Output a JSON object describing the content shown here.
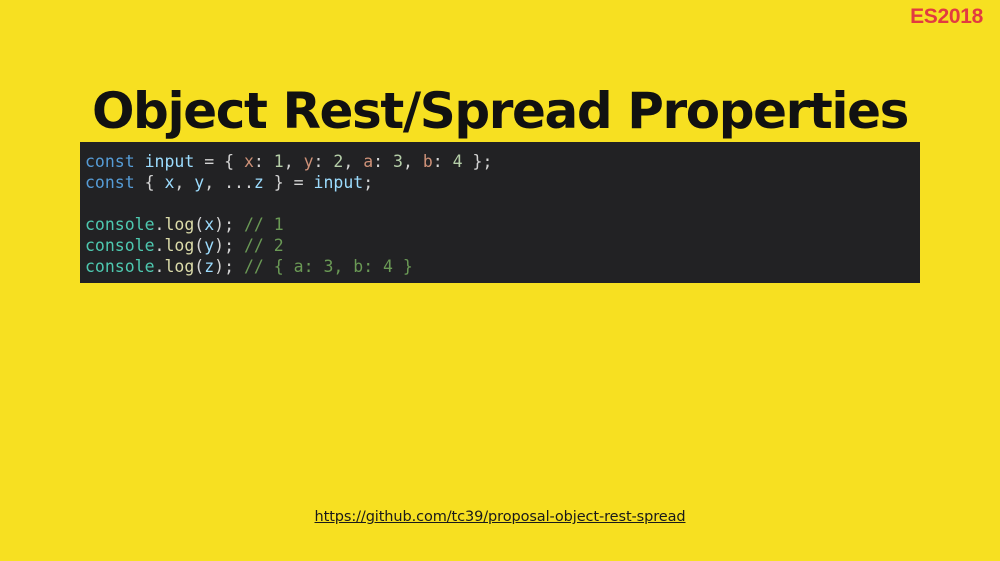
{
  "slide": {
    "background_color": "#F7E021",
    "badge": {
      "label": "ES2018",
      "color": "#E23B40"
    },
    "title": "Object Rest/Spread Properties",
    "title_color": "#111111",
    "source_url": "https://github.com/tc39/proposal-object-rest-spread"
  },
  "code_block": {
    "background_color": "#222224",
    "language": "javascript",
    "theme": "vscode-dark-plus",
    "default_text_color": "#D4D4D4",
    "token_colors": {
      "keyword": "#569CD6",
      "variable": "#9CDCFE",
      "property": "#CE9178",
      "number": "#B5CEA8",
      "object": "#4EC9B0",
      "function": "#DCDCAA",
      "comment": "#6A9955",
      "punctuation": "#D4D4D4"
    },
    "plain_text": "const input = { x: 1, y: 2, a: 3, b: 4 };\nconst { x, y, ...z } = input;\n\nconsole.log(x); // 1\nconsole.log(y); // 2\nconsole.log(z); // { a: 3, b: 4 }",
    "lines": [
      {
        "index": 1,
        "tokens": [
          {
            "t": "const",
            "c": "kw"
          },
          {
            "t": " ",
            "c": "punc"
          },
          {
            "t": "input",
            "c": "var"
          },
          {
            "t": " = { ",
            "c": "punc"
          },
          {
            "t": "x",
            "c": "prop"
          },
          {
            "t": ": ",
            "c": "punc"
          },
          {
            "t": "1",
            "c": "num"
          },
          {
            "t": ", ",
            "c": "punc"
          },
          {
            "t": "y",
            "c": "prop"
          },
          {
            "t": ": ",
            "c": "punc"
          },
          {
            "t": "2",
            "c": "num"
          },
          {
            "t": ", ",
            "c": "punc"
          },
          {
            "t": "a",
            "c": "prop"
          },
          {
            "t": ": ",
            "c": "punc"
          },
          {
            "t": "3",
            "c": "num"
          },
          {
            "t": ", ",
            "c": "punc"
          },
          {
            "t": "b",
            "c": "prop"
          },
          {
            "t": ": ",
            "c": "punc"
          },
          {
            "t": "4",
            "c": "num"
          },
          {
            "t": " };",
            "c": "punc"
          }
        ]
      },
      {
        "index": 2,
        "tokens": [
          {
            "t": "const",
            "c": "kw"
          },
          {
            "t": " { ",
            "c": "punc"
          },
          {
            "t": "x",
            "c": "var"
          },
          {
            "t": ", ",
            "c": "punc"
          },
          {
            "t": "y",
            "c": "var"
          },
          {
            "t": ", ...",
            "c": "punc"
          },
          {
            "t": "z",
            "c": "var"
          },
          {
            "t": " } = ",
            "c": "punc"
          },
          {
            "t": "input",
            "c": "var"
          },
          {
            "t": ";",
            "c": "punc"
          }
        ]
      },
      {
        "index": 3,
        "tokens": []
      },
      {
        "index": 4,
        "tokens": [
          {
            "t": "console",
            "c": "obj"
          },
          {
            "t": ".",
            "c": "punc"
          },
          {
            "t": "log",
            "c": "fn"
          },
          {
            "t": "(",
            "c": "punc"
          },
          {
            "t": "x",
            "c": "var"
          },
          {
            "t": "); ",
            "c": "punc"
          },
          {
            "t": "// 1",
            "c": "comment"
          }
        ]
      },
      {
        "index": 5,
        "tokens": [
          {
            "t": "console",
            "c": "obj"
          },
          {
            "t": ".",
            "c": "punc"
          },
          {
            "t": "log",
            "c": "fn"
          },
          {
            "t": "(",
            "c": "punc"
          },
          {
            "t": "y",
            "c": "var"
          },
          {
            "t": "); ",
            "c": "punc"
          },
          {
            "t": "// 2",
            "c": "comment"
          }
        ]
      },
      {
        "index": 6,
        "tokens": [
          {
            "t": "console",
            "c": "obj"
          },
          {
            "t": ".",
            "c": "punc"
          },
          {
            "t": "log",
            "c": "fn"
          },
          {
            "t": "(",
            "c": "punc"
          },
          {
            "t": "z",
            "c": "var"
          },
          {
            "t": "); ",
            "c": "punc"
          },
          {
            "t": "// { a: 3, b: 4 }",
            "c": "comment"
          }
        ]
      }
    ]
  }
}
